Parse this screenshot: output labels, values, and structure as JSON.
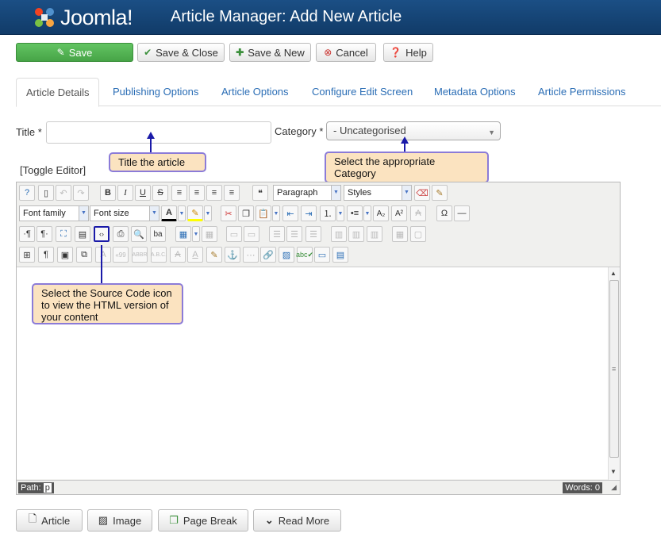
{
  "header": {
    "logo_text": "Joomla!",
    "title": "Article Manager: Add New Article"
  },
  "toolbar": {
    "save": "Save",
    "save_close": "Save & Close",
    "save_new": "Save & New",
    "cancel": "Cancel",
    "help": "Help"
  },
  "tabs": [
    "Article Details",
    "Publishing Options",
    "Article Options",
    "Configure Edit Screen",
    "Metadata Options",
    "Article Permissions"
  ],
  "form": {
    "title_label": "Title *",
    "title_value": "",
    "category_label": "Category *",
    "category_value": "- Uncategorised",
    "toggle_editor": "[Toggle Editor]"
  },
  "callouts": {
    "title": "Title the article",
    "category": "Select the appropriate Category",
    "source": "Select the Source Code icon to view the HTML version of your content"
  },
  "editor": {
    "format_select": "Paragraph",
    "styles_select": "Styles",
    "font_family": "Font family",
    "font_size": "Font size",
    "path_label": "Path:",
    "path_value": "p",
    "words_label": "Words: 0"
  },
  "bottom_buttons": {
    "article": "Article",
    "image": "Image",
    "page_break": "Page Break",
    "read_more": "Read More"
  },
  "colors": {
    "header_bg": "#15457a",
    "save_green": "#51b351",
    "link_blue": "#2a6db5",
    "callout_bg": "#fbe3c0",
    "callout_border": "#8b7bd8",
    "arrow_blue": "#1a1aa8"
  }
}
